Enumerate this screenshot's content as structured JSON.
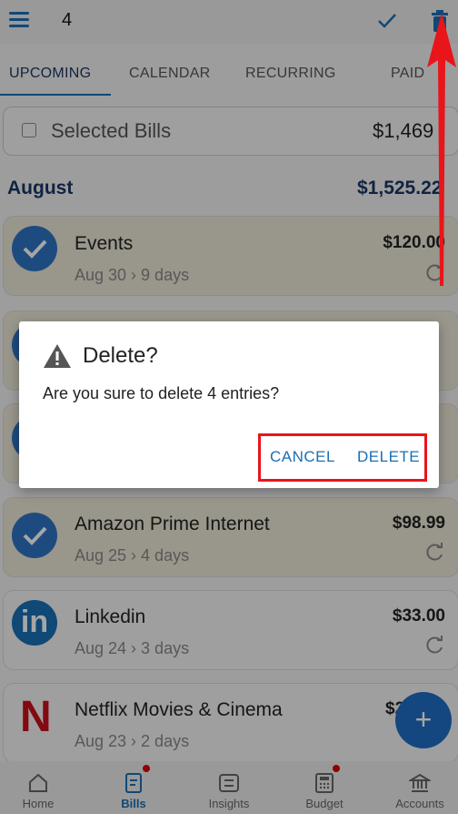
{
  "header": {
    "selected_count": "4",
    "check_icon": "check-icon",
    "delete_icon": "trash-icon"
  },
  "tabs": [
    {
      "label": "UPCOMING",
      "active": true
    },
    {
      "label": "CALENDAR",
      "active": false
    },
    {
      "label": "RECURRING",
      "active": false
    },
    {
      "label": "PAID",
      "active": false
    }
  ],
  "selected_bills": {
    "label": "Selected Bills",
    "amount": "$1,469"
  },
  "month": {
    "name": "August",
    "total": "$1,525.22"
  },
  "bills": [
    {
      "name": "Events",
      "date": "Aug 30 › 9 days",
      "amount": "$120.00",
      "selected": true
    },
    {
      "name": "Amazon Prime Internet",
      "date": "Aug 25 › 4 days",
      "amount": "$98.99",
      "selected": true
    },
    {
      "name": "Linkedin",
      "date": "Aug 24 › 3 days",
      "amount": "$33.00",
      "selected": false
    },
    {
      "name": "Netflix Movies & Cinema",
      "date": "Aug 23 › 2 days",
      "amount": "$2",
      "selected": false
    }
  ],
  "dialog": {
    "title": "Delete?",
    "message": "Are you sure to delete 4 entries?",
    "cancel_label": "CANCEL",
    "delete_label": "DELETE"
  },
  "fab": {
    "label": "+"
  },
  "bottom_nav": [
    {
      "label": "Home",
      "icon": "home-icon",
      "active": false,
      "dot": false
    },
    {
      "label": "Bills",
      "icon": "bills-icon",
      "active": true,
      "dot": true
    },
    {
      "label": "Insights",
      "icon": "insights-icon",
      "active": false,
      "dot": false
    },
    {
      "label": "Budget",
      "icon": "budget-icon",
      "active": false,
      "dot": true
    },
    {
      "label": "Accounts",
      "icon": "accounts-icon",
      "active": false,
      "dot": false
    }
  ],
  "colors": {
    "accent": "#1a6fb5",
    "annotation": "#e8151b",
    "selected_row": "#ece7d6"
  }
}
